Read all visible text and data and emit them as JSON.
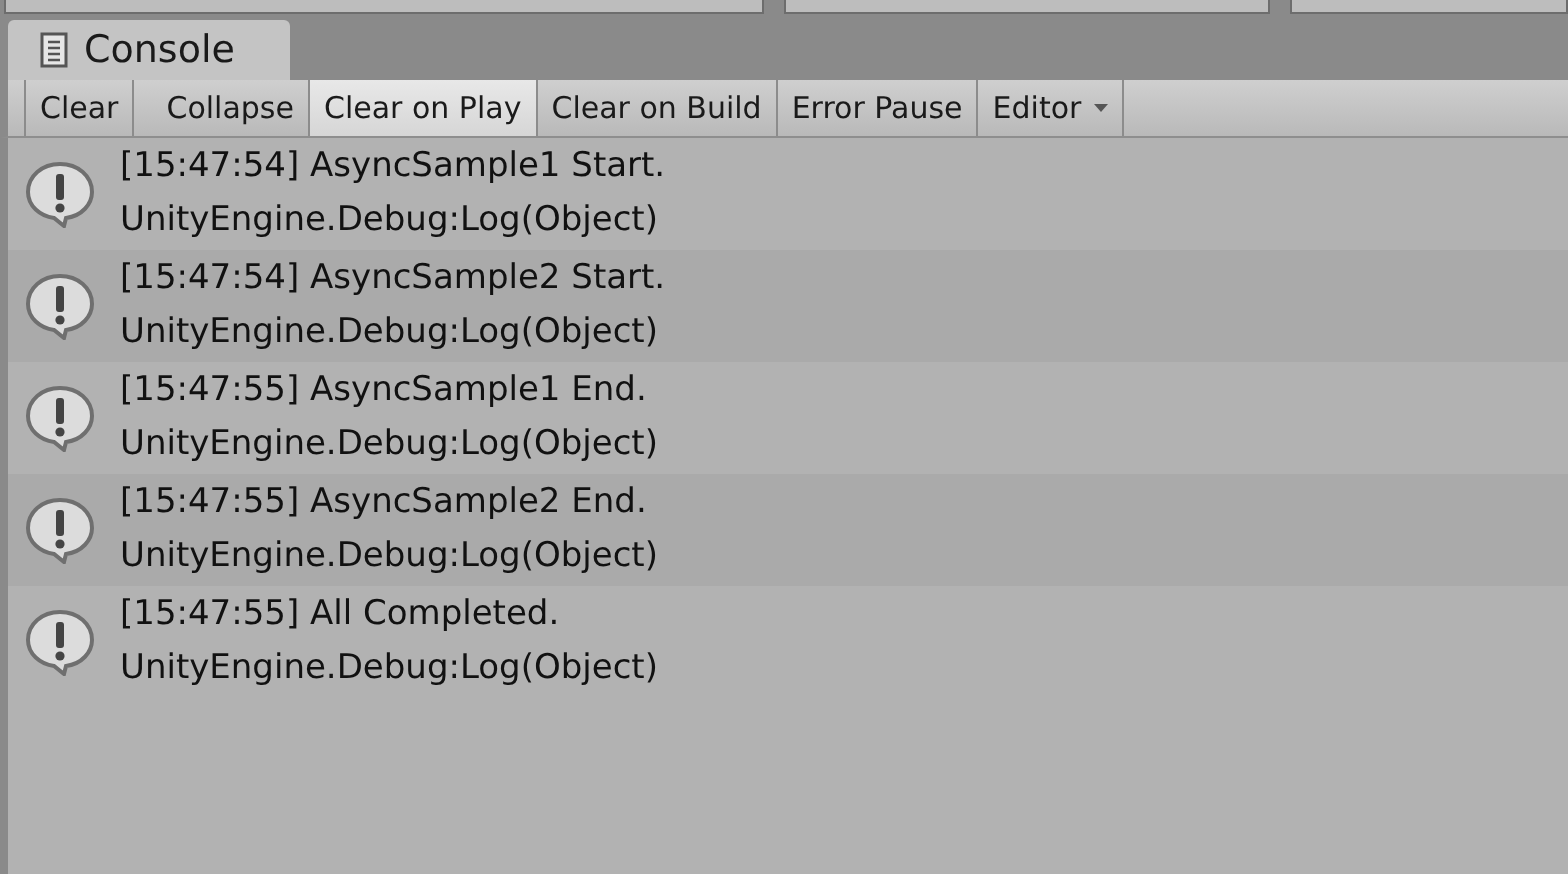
{
  "tab": {
    "title": "Console"
  },
  "toolbar": [
    {
      "label": "Clear",
      "kind": "button"
    },
    {
      "label": "Collapse",
      "kind": "toggle",
      "on": false
    },
    {
      "label": "Clear on Play",
      "kind": "toggle",
      "on": true
    },
    {
      "label": "Clear on Build",
      "kind": "toggle",
      "on": false
    },
    {
      "label": "Error Pause",
      "kind": "toggle",
      "on": false
    },
    {
      "label": "Editor",
      "kind": "dropdown"
    }
  ],
  "entries": [
    {
      "message": "[15:47:54] AsyncSample1 Start.",
      "trace": "UnityEngine.Debug:Log(Object)"
    },
    {
      "message": "[15:47:54] AsyncSample2 Start.",
      "trace": "UnityEngine.Debug:Log(Object)"
    },
    {
      "message": "[15:47:55] AsyncSample1 End.",
      "trace": "UnityEngine.Debug:Log(Object)"
    },
    {
      "message": "[15:47:55] AsyncSample2 End.",
      "trace": "UnityEngine.Debug:Log(Object)"
    },
    {
      "message": "[15:47:55] All Completed.",
      "trace": "UnityEngine.Debug:Log(Object)"
    }
  ]
}
